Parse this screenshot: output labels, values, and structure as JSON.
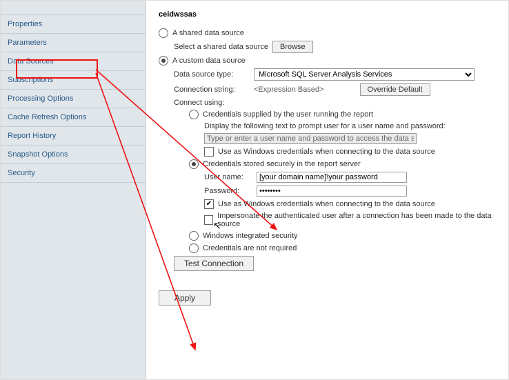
{
  "sidebar": {
    "items": [
      {
        "label": "Properties"
      },
      {
        "label": "Parameters"
      },
      {
        "label": "Data Sources"
      },
      {
        "label": "Subscriptions"
      },
      {
        "label": "Processing Options"
      },
      {
        "label": "Cache Refresh Options"
      },
      {
        "label": "Report History"
      },
      {
        "label": "Snapshot Options"
      },
      {
        "label": "Security"
      }
    ]
  },
  "main": {
    "title": "ceidwssas",
    "shared": {
      "radio_label": "A shared data source",
      "select_label": "Select a shared data source",
      "browse_btn": "Browse"
    },
    "custom": {
      "radio_label": "A custom data source",
      "data_source_type_label": "Data source type:",
      "data_source_type_value": "Microsoft SQL Server Analysis Services",
      "connection_string_label": "Connection string:",
      "connection_string_value": "<Expression Based>",
      "override_btn": "Override Default",
      "connect_using_label": "Connect using:",
      "cred_supplied": {
        "radio_label": "Credentials supplied by the user running the report",
        "prompt_caption": "Display the following text to prompt user for a user name and password:",
        "prompt_placeholder": "Type or enter a user name and password to access the data source:",
        "chk_win": "Use as Windows credentials when connecting to the data source"
      },
      "cred_stored": {
        "radio_label": "Credentials stored securely in the report server",
        "user_label": "User name:",
        "user_value": "[your domain name]\\your password",
        "pass_label": "Password:",
        "pass_value": "••••••••",
        "chk_win": "Use as Windows credentials when connecting to the data source",
        "chk_impersonate": "Impersonate the authenticated user after a connection has been made to the data source"
      },
      "win_integrated_label": "Windows integrated security",
      "no_cred_label": "Credentials are not required",
      "test_btn": "Test Connection"
    },
    "apply_btn": "Apply"
  }
}
